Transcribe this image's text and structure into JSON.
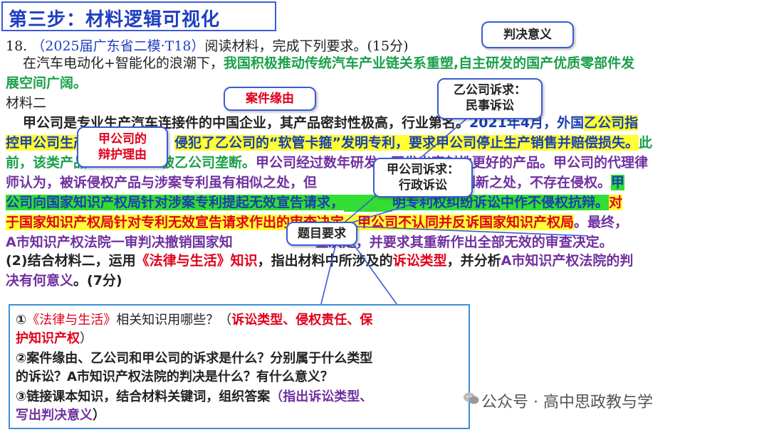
{
  "title": "第三步：材料逻辑可视化",
  "question": {
    "number": "18.",
    "source": "（2025届广东省二模·T18）",
    "instruction": "阅读材料，完成下列要求。(15分)"
  },
  "intro": {
    "part1": "在汽车电动化+智能化的浪潮下，",
    "part2": "我国积极推动传统汽车产业链关系重塑,自主研发的国产优质零部件发",
    "part3": "展空间广阔。"
  },
  "material_label": "材料二",
  "material": {
    "l1a": "甲公司是专业生产汽车连接件的中国企业，其产品密封性极高，行业第名。",
    "l1b": "2021年4月，外国",
    "l1c": "乙公司指",
    "l2a": "控甲公司生产的",
    "l2b": "侵犯了乙公司的“软管卡箍”发明专利，要求甲公司停止生产销售并赔偿损失。",
    "l2c": "此",
    "l3a": "前，该类产品",
    "l3b": "被乙公司垄断。",
    "l3c": "甲公司经过数年研发，开发出密封性更好的产品。甲公司的代理律",
    "l4a": "师认为，被诉侵权产品与涉案专利虽有相似之处，但",
    "l4b": "，而是有创新之处，不存在侵权。",
    "l4c": "甲",
    "l5a": "公司向国家知识产权局针对涉案专利提起无效宣告请求，",
    "l5b": "明专利权纠纷诉讼中作不侵权抗辩。",
    "l5c": "对",
    "l6a": "于国家知识产权局针对专利无效宣告请求作出的审查决定，",
    "l6b": "甲公司不认同并反诉国家知识产权局",
    "l6c": "。最终，",
    "l7a": "A市知识产权法院一审判决撤销国家知",
    "l7b": "查决定，并要求其重新作出全部无效的审查决定。"
  },
  "task": {
    "a": "(2)结合材料二，运用",
    "b": "《法律与生活》知识",
    "c": "，指出材料中所涉及的",
    "d": "诉讼类型",
    "e": "，并分析",
    "f": "A市知识产权法院的判",
    "g": "决有何意义",
    "h": "。(7分)"
  },
  "callouts": {
    "judgment": "判决意义",
    "cause": "案件缘由",
    "b_claim_1": "乙公司诉求：",
    "b_claim_2": "民事诉讼",
    "a_defense_1": "甲公司的",
    "a_defense_2": "辩护理由",
    "a_claim_1": "甲公司诉求：",
    "a_claim_2": "行政诉讼",
    "requirement": "题目要求"
  },
  "bottom": {
    "q1a": "①",
    "q1b": "《法律与生活》",
    "q1c": "相关知识用哪些？（",
    "q1d": "诉讼类型、侵权责任、保",
    "q1e": "护知识产权",
    "q1f": "）",
    "q2a": "②案件缘由、乙公司和甲公司的诉求是什么？分别属于什么类型",
    "q2b": "的诉讼？A市知识产权法院的判决是什么？有什么意义？",
    "q3a": "③链接课本知识，结合材料关键词，组织答案",
    "q3b": "（指出诉讼类型、",
    "q3c": "写出判决意义",
    "q3d": "）"
  },
  "watermark": "公众号 · 高中思政教与学",
  "colors": {
    "title": "#1f3fbf",
    "red": "#e0001b",
    "green": "#1aa04a",
    "blue": "#1a3fb0",
    "purple": "#7030a0",
    "highlight_yellow": "#ffff33",
    "highlight_green": "#33dd33"
  }
}
